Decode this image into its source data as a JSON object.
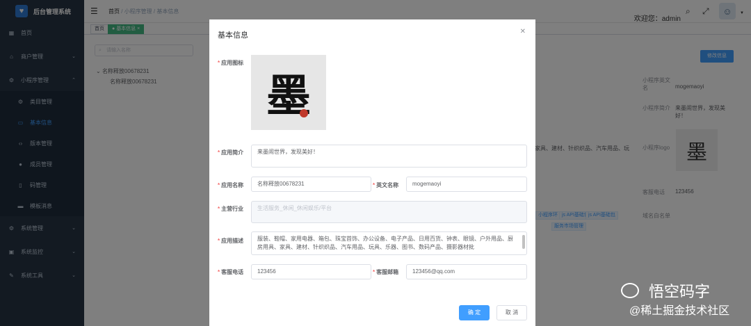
{
  "app": {
    "title": "后台管理系统"
  },
  "sidebar": {
    "items": [
      {
        "label": "首页",
        "icon": "dashboard-icon"
      },
      {
        "label": "商户管理",
        "icon": "shop-icon"
      },
      {
        "label": "小程序管理",
        "icon": "gear-icon"
      },
      {
        "label": "类目管理",
        "icon": "gear-icon"
      },
      {
        "label": "基本信息",
        "icon": "card-icon"
      },
      {
        "label": "版本管理",
        "icon": "code-icon"
      },
      {
        "label": "成员管理",
        "icon": "user-icon"
      },
      {
        "label": "码管理",
        "icon": "phone-icon"
      },
      {
        "label": "模板消息",
        "icon": "message-icon"
      },
      {
        "label": "系统管理",
        "icon": "gear-icon"
      },
      {
        "label": "系统监控",
        "icon": "monitor-icon"
      },
      {
        "label": "系统工具",
        "icon": "tool-icon"
      }
    ]
  },
  "header": {
    "breadcrumb": [
      "首页",
      "小程序管理",
      "基本信息"
    ],
    "welcome": "欢迎您：admin"
  },
  "tags": {
    "items": [
      "首页",
      "基本信息"
    ]
  },
  "tree": {
    "search_placeholder": "请输入名称",
    "root": "名称释放00678231",
    "child": "名称释放00678231"
  },
  "right_panel": {
    "button": "修改信息",
    "rows": [
      {
        "label": "小程序英文名",
        "value": "mogemaoyi"
      },
      {
        "label": "小程序简介",
        "value": "来墨闹世界，发现美好！"
      },
      {
        "label": "小程序logo",
        "value": ""
      },
      {
        "label": "客服电话",
        "value": "123456"
      },
      {
        "label": "域名白名单",
        "value": ""
      }
    ],
    "partial_desc": "家具、建材、针织织品、汽车用品、玩",
    "mini_tags": [
      "小程序环",
      "js API基础包",
      "服务市场管理"
    ]
  },
  "dialog": {
    "title": "基本信息",
    "fields": {
      "icon": {
        "label": "应用图标"
      },
      "intro": {
        "label": "应用简介",
        "value": "来墨闹世界，发现美好！"
      },
      "name": {
        "label": "应用名称",
        "value": "名称释放00678231"
      },
      "en_name": {
        "label": "英文名称",
        "value": "mogemaoyi"
      },
      "industry": {
        "label": "主营行业",
        "value": "生活服务_休闲_休闲娱乐/平台"
      },
      "desc": {
        "label": "应用描述",
        "value": "服装、鞋帽、家用电器、箱包、珠宝首饰、办公设备、电子产品、日用百货、钟表、眼镜、户外用品、厨房用具、家具、建材、针织织品、汽车用品、玩具、乐器、图书、数码产品、摄影器材批"
      },
      "phone": {
        "label": "客服电话",
        "value": "123456"
      },
      "email": {
        "label": "客服邮箱",
        "value": "123456@qq.com"
      }
    },
    "confirm": "确 定",
    "cancel": "取 消"
  },
  "watermark": {
    "brand": "悟空码字",
    "sub": "@稀土掘金技术社区"
  }
}
